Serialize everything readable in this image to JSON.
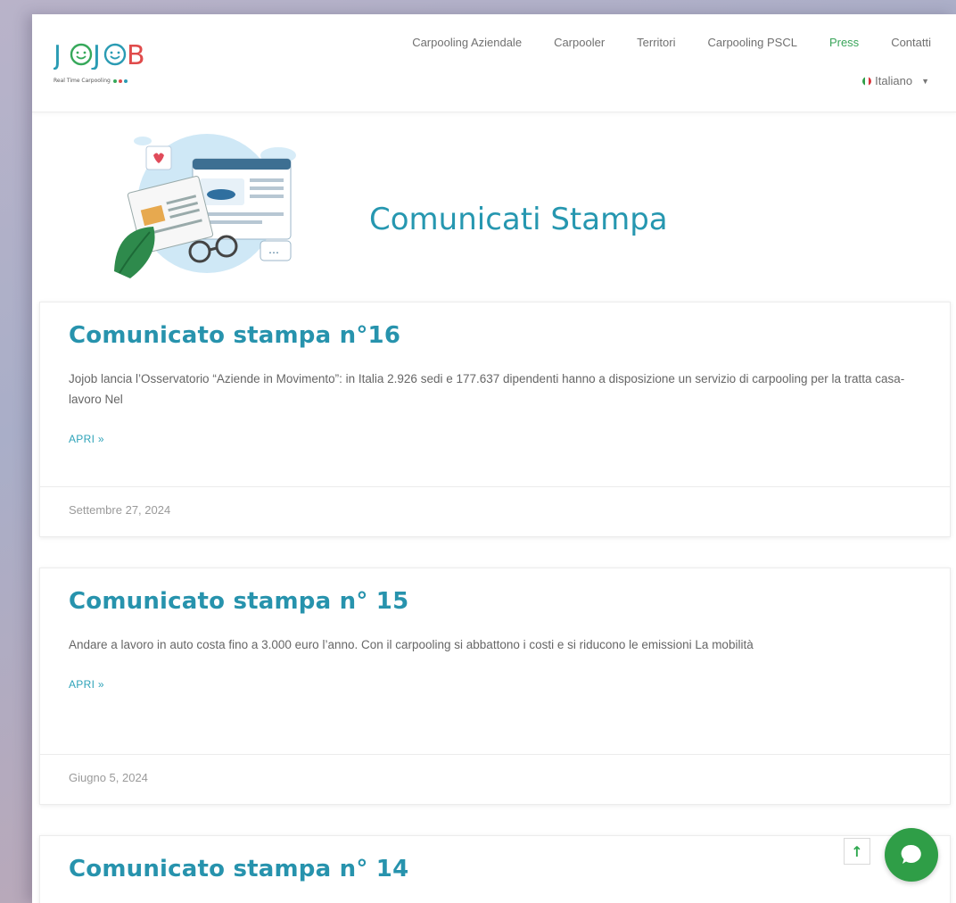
{
  "logo": {
    "text_jo": "J",
    "text_rest": "OJOB",
    "tagline": "Real Time Carpooling"
  },
  "colors": {
    "accent": "#2697b0",
    "nav_active": "#3aa55a",
    "chat": "#2f9e47"
  },
  "nav": {
    "items": [
      {
        "label": "Carpooling Aziendale"
      },
      {
        "label": "Carpooler"
      },
      {
        "label": "Territori"
      },
      {
        "label": "Carpooling PSCL"
      },
      {
        "label": "Press"
      },
      {
        "label": "Contatti"
      }
    ],
    "active": "Press",
    "language": "Italiano"
  },
  "hero": {
    "title": "Comunicati Stampa",
    "illustration": "press-news-illustration"
  },
  "posts": [
    {
      "title": "Comunicato stampa n°16",
      "excerpt": "Jojob lancia l’Osservatorio “Aziende in Movimento”: in Italia 2.926 sedi e 177.637 dipendenti hanno a disposizione un servizio di carpooling per la tratta casa-lavoro Nel",
      "more": "APRI »",
      "date": "Settembre 27, 2024"
    },
    {
      "title": "Comunicato stampa n° 15",
      "excerpt": "Andare a lavoro in auto costa fino a 3.000 euro l’anno. Con il carpooling si abbattono i costi e si riducono le emissioni La mobilità",
      "more": "APRI »",
      "date": "Giugno 5, 2024"
    },
    {
      "title": "Comunicato stampa n° 14"
    }
  ],
  "icons": {
    "scroll_top": "arrow-up-icon",
    "chat": "chat-bubble-icon"
  }
}
